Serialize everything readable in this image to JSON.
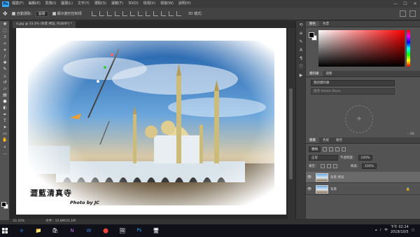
{
  "menubar": {
    "logo": "Ps",
    "items": [
      "檔案(F)",
      "編輯(E)",
      "影像(I)",
      "圖層(L)",
      "文字(Y)",
      "選取(S)",
      "濾鏡(T)",
      "3D(D)",
      "檢視(V)",
      "視窗(W)",
      "說明(H)"
    ]
  },
  "options": {
    "auto_select_label": "自動選取：",
    "auto_select_value": "圖層",
    "show_transform_label": "顯示變形控制項",
    "mode_3d": "3D 模式："
  },
  "document": {
    "tab_title": "a.jpg @ 33.3% (背景 拷貝, RGB/8*) *",
    "watermark": "澀藍清真寺",
    "credit": "Photo by JC"
  },
  "status": {
    "zoom": "33.33%",
    "doc_size": "文件：15.8M/31.1M"
  },
  "panels": {
    "color_tabs": [
      "顏色",
      "色票"
    ],
    "library_tabs": [
      "資料庫",
      "調整"
    ],
    "library_dropdown": "我的資料庫",
    "library_search_placeholder": "搜尋 Adobe Stock",
    "library_size": "-- KB",
    "layers_tabs": [
      "圖層",
      "色版",
      "路徑"
    ],
    "kind_filter": "種類",
    "blend_mode": "正常",
    "opacity_label": "不透明度：",
    "opacity_value": "100%",
    "lock_label": "鎖定：",
    "fill_label": "填滿：",
    "fill_value": "100%",
    "layers": [
      {
        "name": "背景 拷貝",
        "active": true
      },
      {
        "name": "背景",
        "active": false
      }
    ]
  },
  "taskbar": {
    "apps": [
      "e",
      "📁",
      "🛍",
      "N",
      "W",
      "⬤",
      "🖼",
      "Ps",
      "🖥"
    ],
    "lang": "中",
    "time": "下午 02:24",
    "date": "2018/10/5"
  },
  "colors": {
    "accent": "#31a8ff",
    "panel_bg": "#535353",
    "canvas_bg": "#282828"
  }
}
